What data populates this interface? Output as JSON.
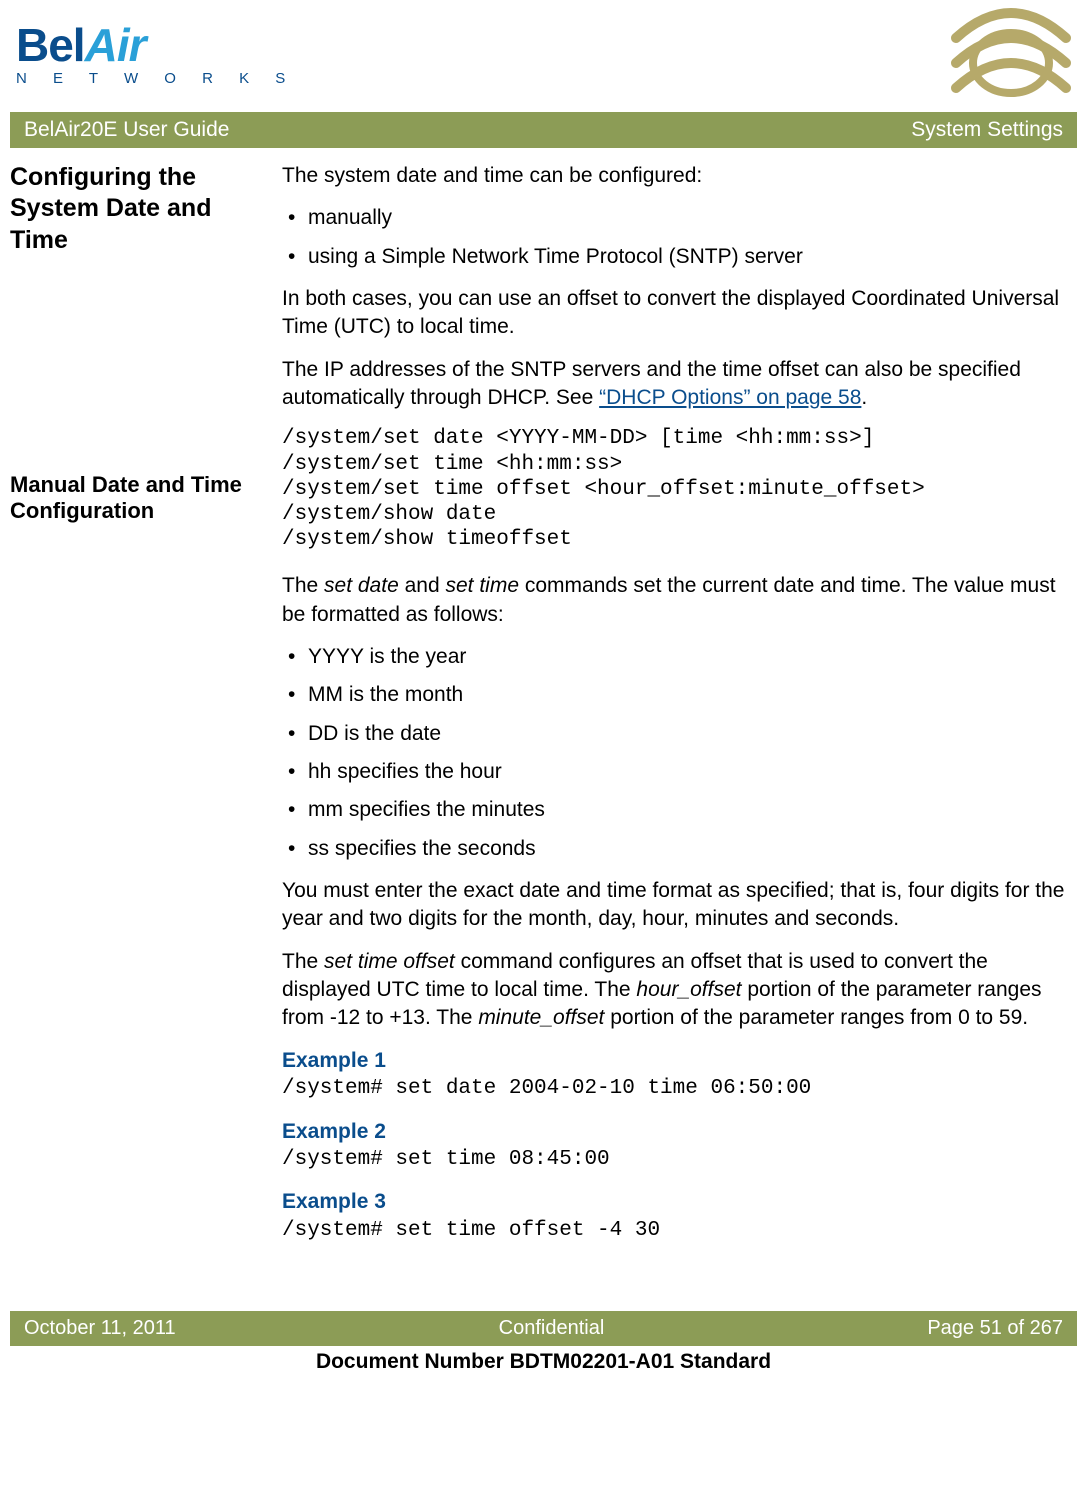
{
  "logo": {
    "brand_prefix": "Bel",
    "brand_suffix": "Air",
    "subtitle": "N E T W O R K S"
  },
  "header_bar": {
    "left": "BelAir20E User Guide",
    "right": "System Settings"
  },
  "side": {
    "h1": "Configuring the System Date and Time",
    "h2": "Manual Date and Time Configuration"
  },
  "intro": {
    "p1": "The system date and time can be configured:",
    "bullets1": [
      "manually",
      "using a Simple Network Time Protocol (SNTP) server"
    ],
    "p2": "In both cases, you can use an offset to convert the displayed Coordinated Universal Time (UTC) to local time.",
    "p3_a": "The IP addresses of the SNTP servers and the time offset can also be specified automatically through DHCP. See ",
    "p3_link": "“DHCP Options” on page 58",
    "p3_b": "."
  },
  "code1": "/system/set date <YYYY-MM-DD> [time <hh:mm:ss>]\n/system/set time <hh:mm:ss>\n/system/set time offset <hour_offset:minute_offset>\n/system/show date\n/system/show timeoffset",
  "body": {
    "p4_a": "The ",
    "p4_i1": "set date",
    "p4_b": " and ",
    "p4_i2": "set time",
    "p4_c": " commands set the current date and time. The value must be formatted as follows:",
    "bullets2": [
      "YYYY is the year",
      "MM is the month",
      "DD is the date",
      "hh specifies the hour",
      "mm specifies the minutes",
      "ss specifies the seconds"
    ],
    "p5": "You must enter the exact date and time format as specified; that is, four digits for the year and two digits for the month, day, hour, minutes and seconds.",
    "p6_a": "The ",
    "p6_i1": "set time offset",
    "p6_b": " command configures an offset that is used to convert the displayed UTC time to local time. The ",
    "p6_i2": "hour_offset",
    "p6_c": " portion of the parameter ranges from -12 to +13. The ",
    "p6_i3": "minute_offset",
    "p6_d": " portion of the parameter ranges from 0 to 59."
  },
  "examples": [
    {
      "label": "Example 1",
      "code": "/system# set date 2004-02-10 time 06:50:00"
    },
    {
      "label": "Example 2",
      "code": "/system# set time 08:45:00"
    },
    {
      "label": "Example 3",
      "code": "/system# set time offset -4 30"
    }
  ],
  "footer_bar": {
    "left": "October 11, 2011",
    "center": "Confidential",
    "right": "Page 51 of 267"
  },
  "doc_number": "Document Number BDTM02201-A01 Standard"
}
